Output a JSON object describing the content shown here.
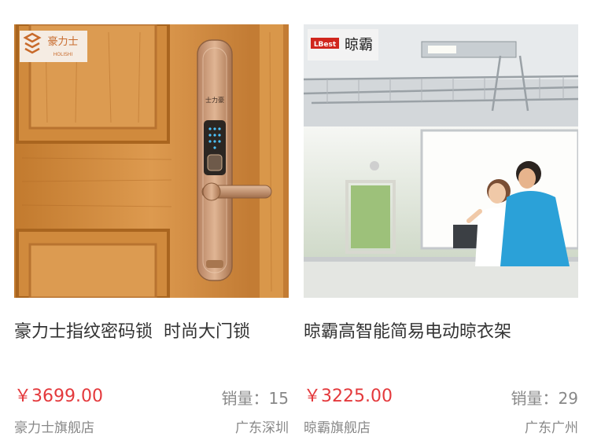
{
  "products": [
    {
      "title": "豪力士指纹密码锁  时尚大门锁",
      "price": "￥3699.00",
      "sales": "销量：15",
      "store": "豪力士旗舰店",
      "location": "广东深圳",
      "brand_logo": {
        "name": "豪力士",
        "sub": "HOLISHI"
      }
    },
    {
      "title": "晾霸高智能简易电动晾衣架",
      "price": "￥3225.00",
      "sales": "销量：29",
      "store": "晾霸旗舰店",
      "location": "广东广州",
      "brand_logo": {
        "name": "晾霸",
        "mark": "LBest"
      }
    }
  ],
  "colors": {
    "price": "#e4393c",
    "muted": "#888888",
    "title": "#333333",
    "door_wood": "#cf8a3f",
    "lock_gold": "#c99a72"
  }
}
